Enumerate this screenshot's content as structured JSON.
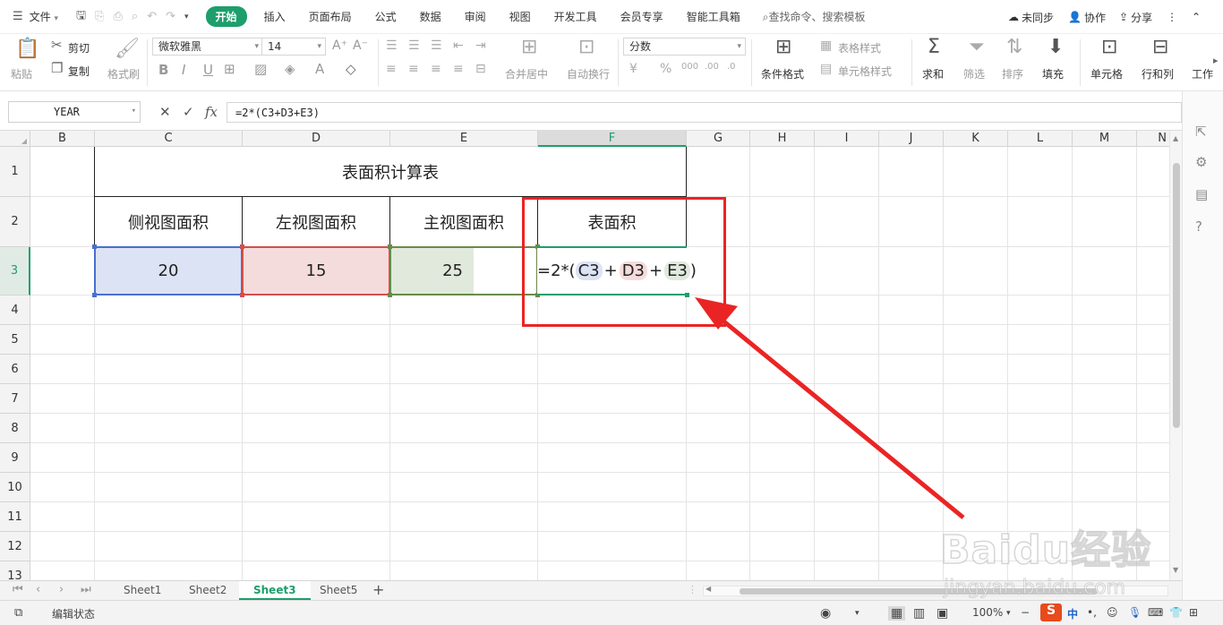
{
  "menu": {
    "file_label": "文件",
    "tabs": [
      "开始",
      "插入",
      "页面布局",
      "公式",
      "数据",
      "审阅",
      "视图",
      "开发工具",
      "会员专享",
      "智能工具箱"
    ],
    "active_tab": "开始",
    "search_placeholder": "查找命令、搜索模板",
    "sync_label": "未同步",
    "collab_label": "协作",
    "share_label": "分享"
  },
  "ribbon": {
    "paste": "粘贴",
    "cut": "剪切",
    "copy": "复制",
    "format_painter": "格式刷",
    "font_name": "微软雅黑",
    "font_size": "14",
    "merge_center": "合并居中",
    "wrap_text": "自动换行",
    "number_format": "分数",
    "conditional_format": "条件格式",
    "table_style": "表格样式",
    "cell_style": "单元格样式",
    "sum": "求和",
    "filter": "筛选",
    "sort": "排序",
    "fill": "填充",
    "cell": "单元格",
    "row_col": "行和列",
    "worksheet": "工作"
  },
  "formula_bar": {
    "name_box": "YEAR",
    "formula": "=2*(C3+D3+E3)"
  },
  "grid": {
    "columns": [
      "B",
      "C",
      "D",
      "E",
      "F",
      "G",
      "H",
      "I",
      "J",
      "K",
      "L",
      "M",
      "N"
    ],
    "selected_column": "F",
    "rows": [
      "1",
      "2",
      "3",
      "4",
      "5",
      "6",
      "7",
      "8",
      "9",
      "10",
      "11",
      "12",
      "13"
    ],
    "selected_row": "3",
    "title": "表面积计算表",
    "headers": [
      "侧视图面积",
      "左视图面积",
      "主视图面积",
      "表面积"
    ],
    "values": [
      "20",
      "15",
      "25"
    ],
    "formula_display": {
      "prefix": "=2*(",
      "ref1": "C3",
      "plus1": "+",
      "ref2": "D3",
      "plus2": "+",
      "ref3": "E3",
      "suffix": ")"
    },
    "colors": {
      "ref_c": "#dce3f4",
      "ref_d": "#f5dcdc",
      "ref_e": "#e1e9dc",
      "border_c": "#4a6fd0",
      "border_d": "#d05050",
      "border_e": "#6a8a4a",
      "accent": "#1e9e6c",
      "annotation": "#ea2424"
    }
  },
  "sheets": {
    "tabs": [
      "Sheet1",
      "Sheet2",
      "Sheet3",
      "Sheet5"
    ],
    "active": "Sheet3",
    "add_label": "+"
  },
  "status": {
    "mode": "编辑状态",
    "zoom": "100%",
    "ime": "中"
  },
  "watermark": {
    "brand": "Baidu经验",
    "url": "jingyan.baidu.com"
  }
}
